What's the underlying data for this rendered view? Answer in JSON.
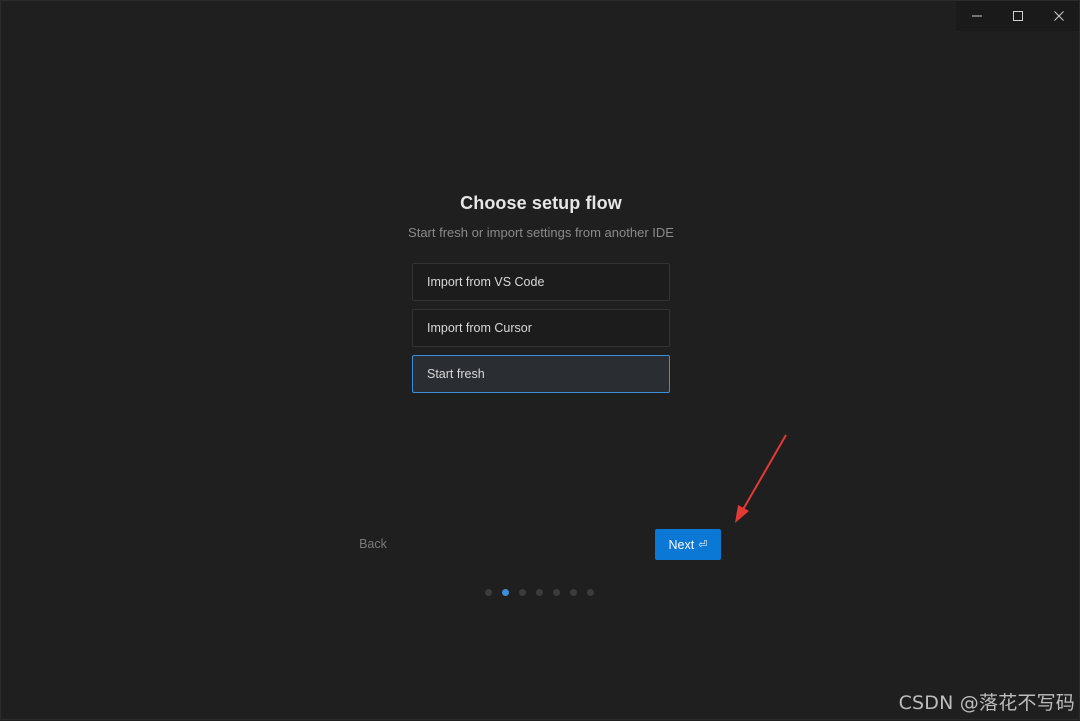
{
  "window_controls": {
    "minimize_icon": "minimize-icon",
    "maximize_icon": "maximize-icon",
    "close_icon": "close-icon"
  },
  "setup": {
    "title": "Choose setup flow",
    "subtitle": "Start fresh or import settings from another IDE",
    "options": [
      {
        "label": "Import from VS Code",
        "selected": false
      },
      {
        "label": "Import from Cursor",
        "selected": false
      },
      {
        "label": "Start fresh",
        "selected": true
      }
    ],
    "back_label": "Back",
    "next_label": "Next",
    "next_icon": "⏎",
    "steps_total": 7,
    "current_step": 2
  },
  "annotation": {
    "arrow_color": "#e53935"
  },
  "colors": {
    "accent": "#0a78d4",
    "selected_border": "#3b8fd9",
    "background": "#1f1f1f"
  },
  "watermark": "CSDN @落花不写码"
}
